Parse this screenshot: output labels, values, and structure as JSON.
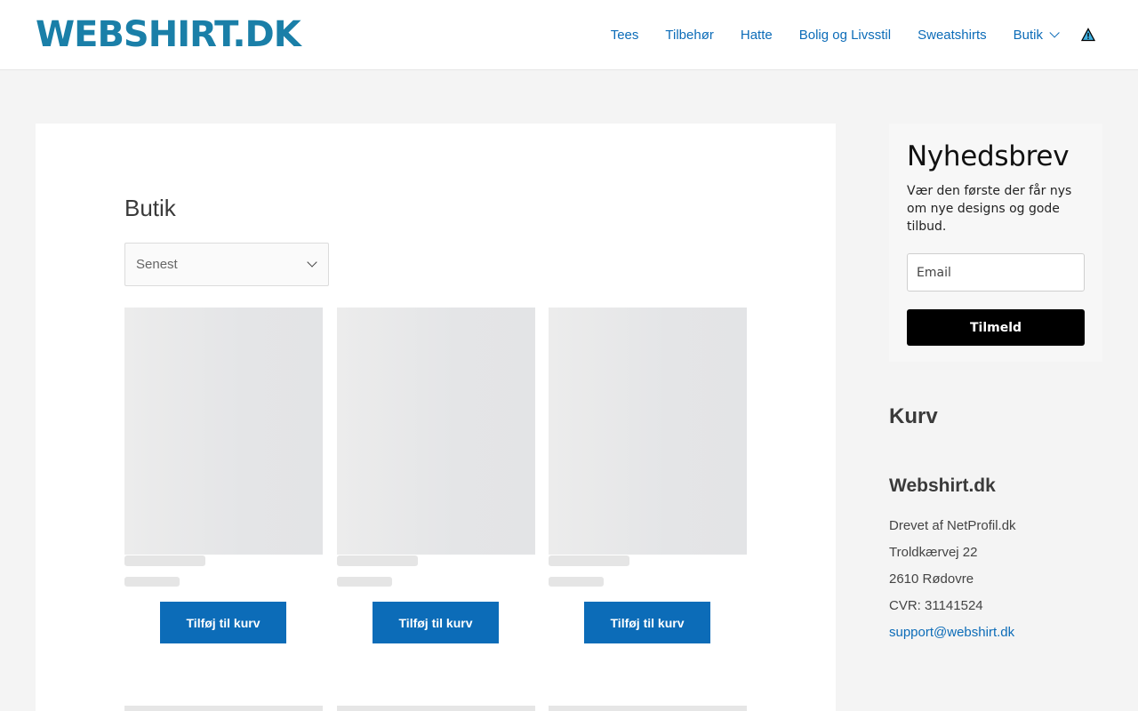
{
  "header": {
    "logo_text": "WEBSHIRT.DK",
    "nav": [
      "Tees",
      "Tilbehør",
      "Hatte",
      "Bolig og Livsstil",
      "Sweatshirts",
      "Butik"
    ]
  },
  "main": {
    "title": "Butik",
    "sort_selected": "Senest",
    "add_to_cart_label": "Tilføj til kurv"
  },
  "newsletter": {
    "title": "Nyhedsbrev",
    "description": "Vær den første der får nys om nye designs og gode tilbud.",
    "email_placeholder": "Email",
    "submit_label": "Tilmeld"
  },
  "sidebar": {
    "cart_title": "Kurv",
    "company_title": "Webshirt.dk",
    "lines": [
      "Drevet af NetProfil.dk",
      "Troldkærvej 22",
      "2610 Rødovre",
      "CVR: 31141524"
    ],
    "email_link": "support@webshirt.dk"
  },
  "colors": {
    "accent": "#0c6cb8",
    "logo": "#1a7fa8",
    "button_dark": "#000000"
  }
}
